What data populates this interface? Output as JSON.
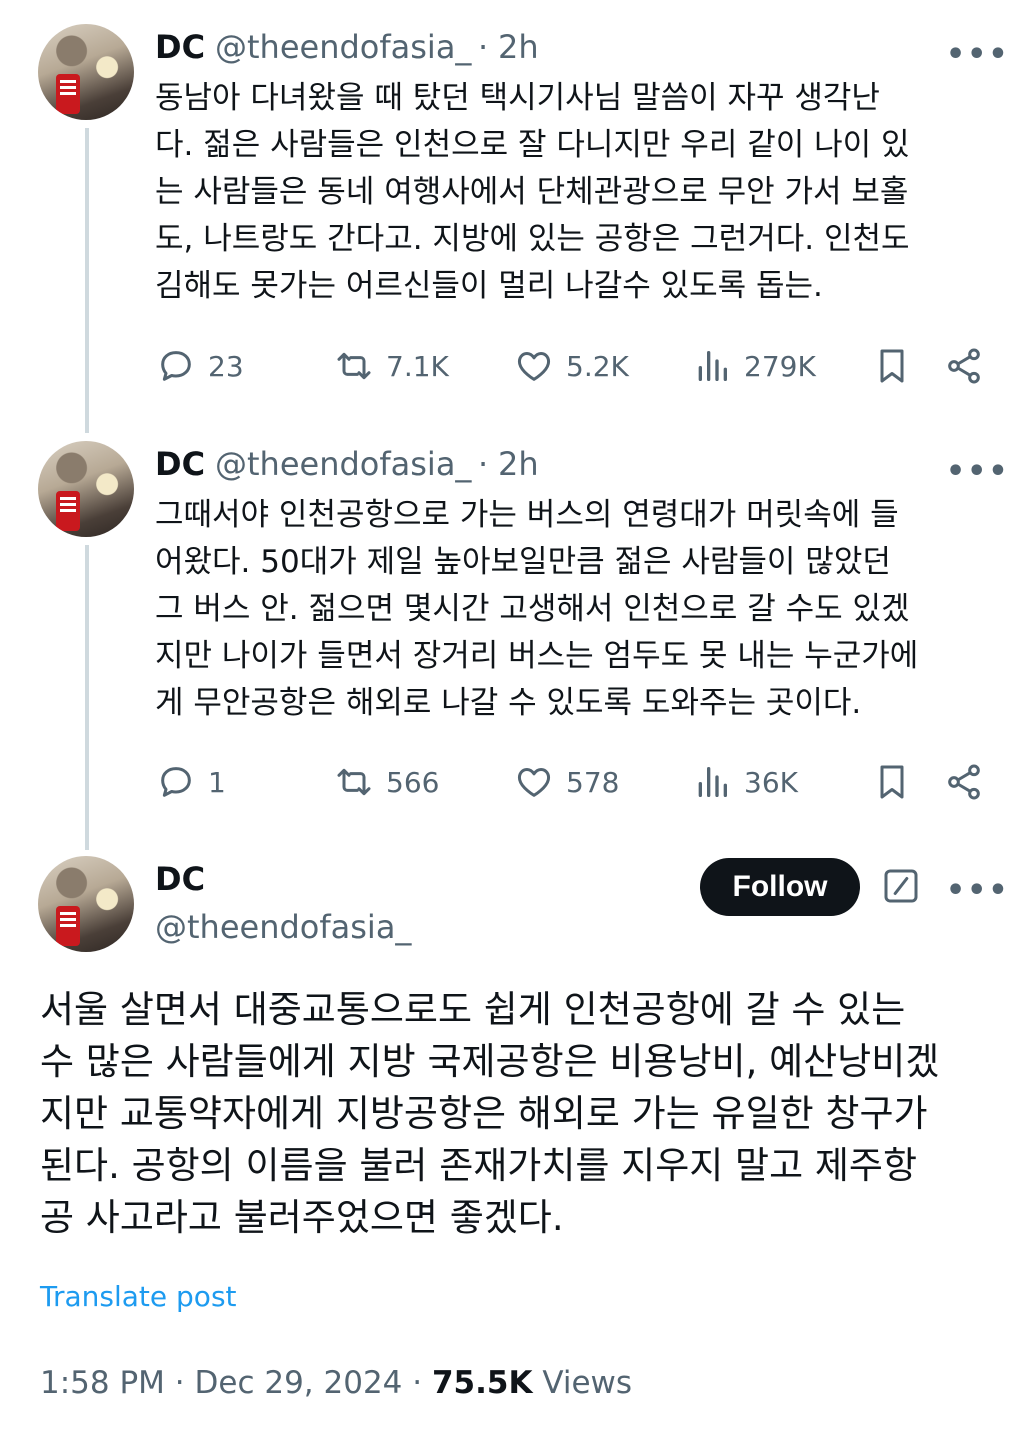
{
  "thread": [
    {
      "display_name": "DC",
      "handle": "@theendofasia_",
      "separator": "·",
      "time": "2h",
      "more": "•••",
      "text": "동남아 다녀왔을 때 탔던 택시기사님 말씀이 자꾸 생각난\n다. 젊은 사람들은 인천으로 잘 다니지만 우리 같이 나이 있\n는 사람들은 동네 여행사에서 단체관광으로 무안 가서 보홀\n도, 나트랑도 간다고. 지방에 있는 공항은 그런거다. 인천도\n김해도 못가는 어르신들이 멀리 나갈수 있도록 돕는.",
      "replies": "23",
      "reposts": "7.1K",
      "likes": "5.2K",
      "views": "279K"
    },
    {
      "display_name": "DC",
      "handle": "@theendofasia_",
      "separator": "·",
      "time": "2h",
      "more": "•••",
      "text": "그때서야 인천공항으로 가는 버스의 연령대가 머릿속에 들\n어왔다. 50대가 제일 높아보일만큼 젊은 사람들이 많았던\n그 버스 안. 젊으면 몇시간 고생해서 인천으로 갈 수도 있겠\n지만 나이가 들면서 장거리 버스는 엄두도 못 내는 누군가에\n게 무안공항은 해외로 나갈 수 있도록 도와주는 곳이다.",
      "replies": "1",
      "reposts": "566",
      "likes": "578",
      "views": "36K"
    }
  ],
  "main_post": {
    "display_name": "DC",
    "handle": "@theendofasia_",
    "follow_label": "Follow",
    "more": "•••",
    "text": "서울 살면서 대중교통으로도 쉽게 인천공항에 갈 수 있는\n수 많은 사람들에게 지방 국제공항은 비용낭비, 예산낭비겠\n지만 교통약자에게 지방공항은 해외로 가는 유일한 창구가\n된다. 공항의 이름을 불러 존재가치를 지우지 말고 제주항\n공 사고라고 불러주었으면 좋겠다.",
    "translate_label": "Translate post",
    "time": "1:58 PM",
    "date": "Dec 29, 2024",
    "separator": "·",
    "views_count": "75.5K",
    "views_label": "Views"
  },
  "icons": [
    "reply-icon",
    "repost-icon",
    "like-icon",
    "views-icon",
    "bookmark-icon",
    "share-icon",
    "grok-icon",
    "more-icon"
  ],
  "colors": {
    "text": "#0f1419",
    "secondary": "#536471",
    "link": "#1d9bf0",
    "follow_bg": "#0f1419",
    "thread_line": "#cfd9de"
  }
}
